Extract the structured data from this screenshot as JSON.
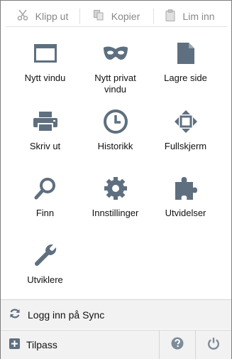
{
  "edit": {
    "cut": "Klipp ut",
    "copy": "Kopier",
    "paste": "Lim inn"
  },
  "tiles": [
    {
      "label": "Nytt vindu",
      "icon": "window-icon"
    },
    {
      "label": "Nytt privat vindu",
      "icon": "private-mask-icon"
    },
    {
      "label": "Lagre side",
      "icon": "page-icon"
    },
    {
      "label": "Skriv ut",
      "icon": "printer-icon"
    },
    {
      "label": "Historikk",
      "icon": "clock-icon"
    },
    {
      "label": "Fullskjerm",
      "icon": "fullscreen-icon"
    },
    {
      "label": "Finn",
      "icon": "magnifier-icon"
    },
    {
      "label": "Innstillinger",
      "icon": "gear-icon"
    },
    {
      "label": "Utvidelser",
      "icon": "puzzle-icon"
    },
    {
      "label": "Utviklere",
      "icon": "wrench-icon"
    }
  ],
  "footer": {
    "sync": "Logg inn på Sync",
    "customize": "Tilpass"
  },
  "colors": {
    "icon": "#5e6f7f",
    "footer_bg": "#f2f2f2",
    "disabled_text": "#888888"
  }
}
